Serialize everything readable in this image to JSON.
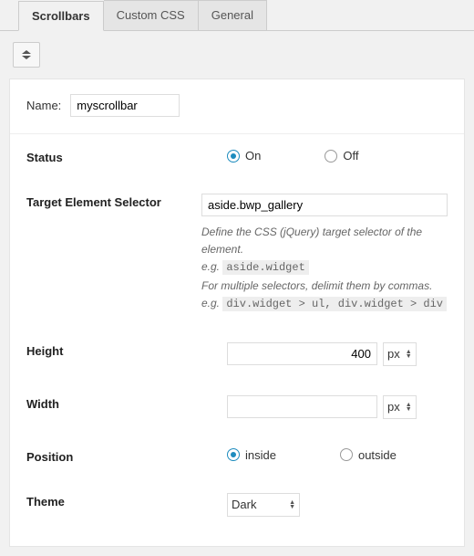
{
  "tabs": {
    "scrollbars": "Scrollbars",
    "custom_css": "Custom CSS",
    "general": "General"
  },
  "name": {
    "label": "Name:",
    "value": "myscrollbar"
  },
  "status": {
    "label": "Status",
    "on": "On",
    "off": "Off"
  },
  "target": {
    "label": "Target Element Selector",
    "value": "aside.bwp_gallery",
    "help1": "Define the CSS (jQuery) target selector of the element.",
    "help2_prefix": "e.g. ",
    "help2_code": "aside.widget",
    "help3": "For multiple selectors, delimit them by commas.",
    "help4_prefix": "e.g. ",
    "help4_code": "div.widget > ul, div.widget > div"
  },
  "height": {
    "label": "Height",
    "value": "400",
    "unit": "px"
  },
  "width": {
    "label": "Width",
    "value": "",
    "unit": "px"
  },
  "position": {
    "label": "Position",
    "inside": "inside",
    "outside": "outside"
  },
  "theme": {
    "label": "Theme",
    "value": "Dark"
  }
}
